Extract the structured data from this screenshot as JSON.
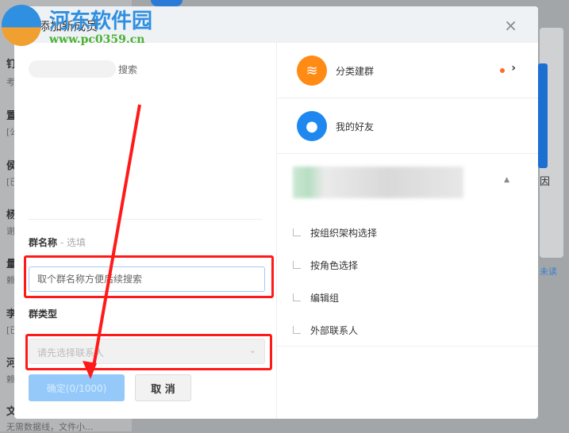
{
  "background": {
    "items": [
      "钉",
      "考",
      "置",
      "[公",
      "侯",
      "[已",
      "杨",
      "谢",
      "量",
      "赖",
      "李",
      "[已",
      "河",
      "赖",
      "文"
    ],
    "last_sub": "无需数据线，文件小...",
    "right_text": "未读",
    "right_char": "因"
  },
  "watermark": {
    "title": "河东软件园",
    "url": "www.pc0359.cn"
  },
  "modal": {
    "title": "添加新成员",
    "close": "×"
  },
  "left": {
    "search_label": "搜索",
    "group_name_label": "群名称",
    "group_name_optional": " - 选填",
    "group_name_placeholder": "取个群名称方便后续搜索",
    "group_type_label": "群类型",
    "group_type_placeholder": "请先选择联系人",
    "confirm": "确定(0/1000)",
    "cancel": "取 消"
  },
  "right": {
    "category": "分类建群",
    "friends": "我的好友",
    "sub_items": [
      "按组织架构选择",
      "按角色选择",
      "编辑组",
      "外部联系人"
    ]
  },
  "colors": {
    "highlight": "#ff1a1a",
    "orange": "#ff8a14",
    "blue": "#1e88f0"
  }
}
